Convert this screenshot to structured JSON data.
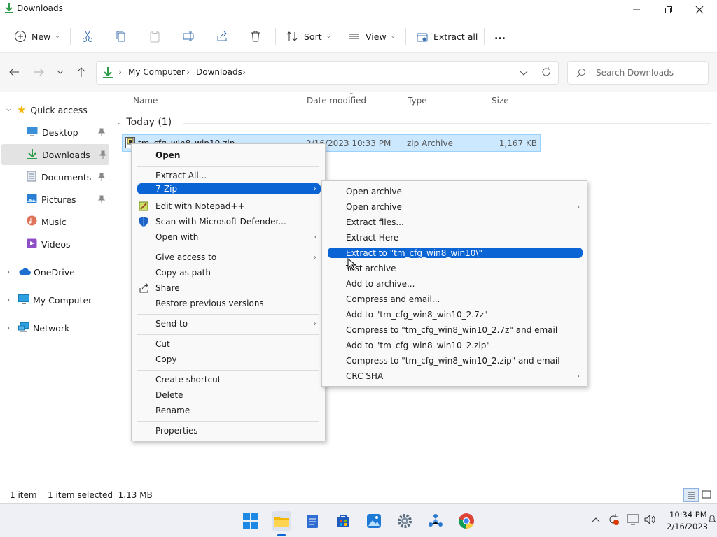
{
  "window": {
    "title": "Downloads"
  },
  "toolbar": {
    "new_label": "New",
    "sort_label": "Sort",
    "view_label": "View",
    "extract_all_label": "Extract all",
    "more_label": "..."
  },
  "address": {
    "crumbs": [
      "My Computer",
      "Downloads"
    ],
    "search_placeholder": "Search Downloads"
  },
  "sidebar": {
    "quick_access": "Quick access",
    "items": [
      {
        "label": "Desktop",
        "pinned": true
      },
      {
        "label": "Downloads",
        "pinned": true
      },
      {
        "label": "Documents",
        "pinned": true
      },
      {
        "label": "Pictures",
        "pinned": true
      },
      {
        "label": "Music",
        "pinned": false
      },
      {
        "label": "Videos",
        "pinned": false
      }
    ],
    "roots": [
      "OneDrive",
      "My Computer",
      "Network"
    ]
  },
  "columns": {
    "name": "Name",
    "date": "Date modified",
    "type": "Type",
    "size": "Size"
  },
  "group": {
    "label": "Today (1)"
  },
  "file": {
    "name": "tm_cfg_win8_win10.zip",
    "date": "2/16/2023 10:33 PM",
    "type": "zip Archive",
    "size": "1,167 KB"
  },
  "context_menu": {
    "open": "Open",
    "extract_all": "Extract All...",
    "seven_zip": "7-Zip",
    "edit_notepad": "Edit with Notepad++",
    "scan_defender": "Scan with Microsoft Defender...",
    "open_with": "Open with",
    "give_access": "Give access to",
    "copy_path": "Copy as path",
    "share": "Share",
    "restore": "Restore previous versions",
    "send_to": "Send to",
    "cut": "Cut",
    "copy": "Copy",
    "create_shortcut": "Create shortcut",
    "delete": "Delete",
    "rename": "Rename",
    "properties": "Properties"
  },
  "submenu": {
    "items": [
      "Open archive",
      "Open archive",
      "Extract files...",
      "Extract Here",
      "Extract to \"tm_cfg_win8_win10\\\"",
      "Test archive",
      "Add to archive...",
      "Compress and email...",
      "Add to \"tm_cfg_win8_win10_2.7z\"",
      "Compress to \"tm_cfg_win8_win10_2.7z\" and email",
      "Add to \"tm_cfg_win8_win10_2.zip\"",
      "Compress to \"tm_cfg_win8_win10_2.zip\" and email",
      "CRC SHA"
    ]
  },
  "status": {
    "count": "1 item",
    "selected": "1 item selected  1.13 MB"
  },
  "clock": {
    "time": "10:34 PM",
    "date": "2/16/2023"
  },
  "colors": {
    "accent": "#0a64d4",
    "selection": "#cce8ff",
    "folder": "#f2b705"
  }
}
